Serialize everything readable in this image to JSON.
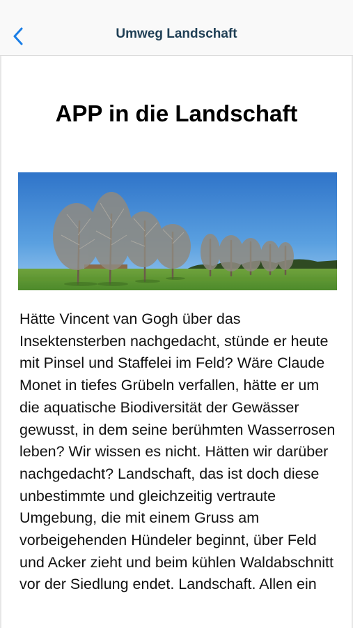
{
  "header": {
    "title": "Umweg Landschaft",
    "back_icon": "chevron-left-icon",
    "accent_color": "#1a7ee6"
  },
  "article": {
    "heading": "APP in die Landschaft",
    "image": {
      "subject": "landscape-photo"
    },
    "body": "Hätte Vincent van Gogh über das Insektensterben nachgedacht, stünde er heute mit Pinsel und Staffelei im Feld? Wäre Claude Monet in tiefes Grübeln verfallen, hätte er um die aquatische Biodiversität der Gewässer gewusst, in dem seine berühmten Wasserrosen leben? Wir wissen es nicht. Hätten wir darüber nachgedacht? Landschaft, das ist doch diese unbestimmte und gleichzeitig vertraute Umgebung, die mit einem Gruss am vorbeigehenden Hündeler beginnt, über Feld und Acker zieht und beim kühlen Waldabschnitt vor der Siedlung endet. Landschaft. Allen ein"
  }
}
